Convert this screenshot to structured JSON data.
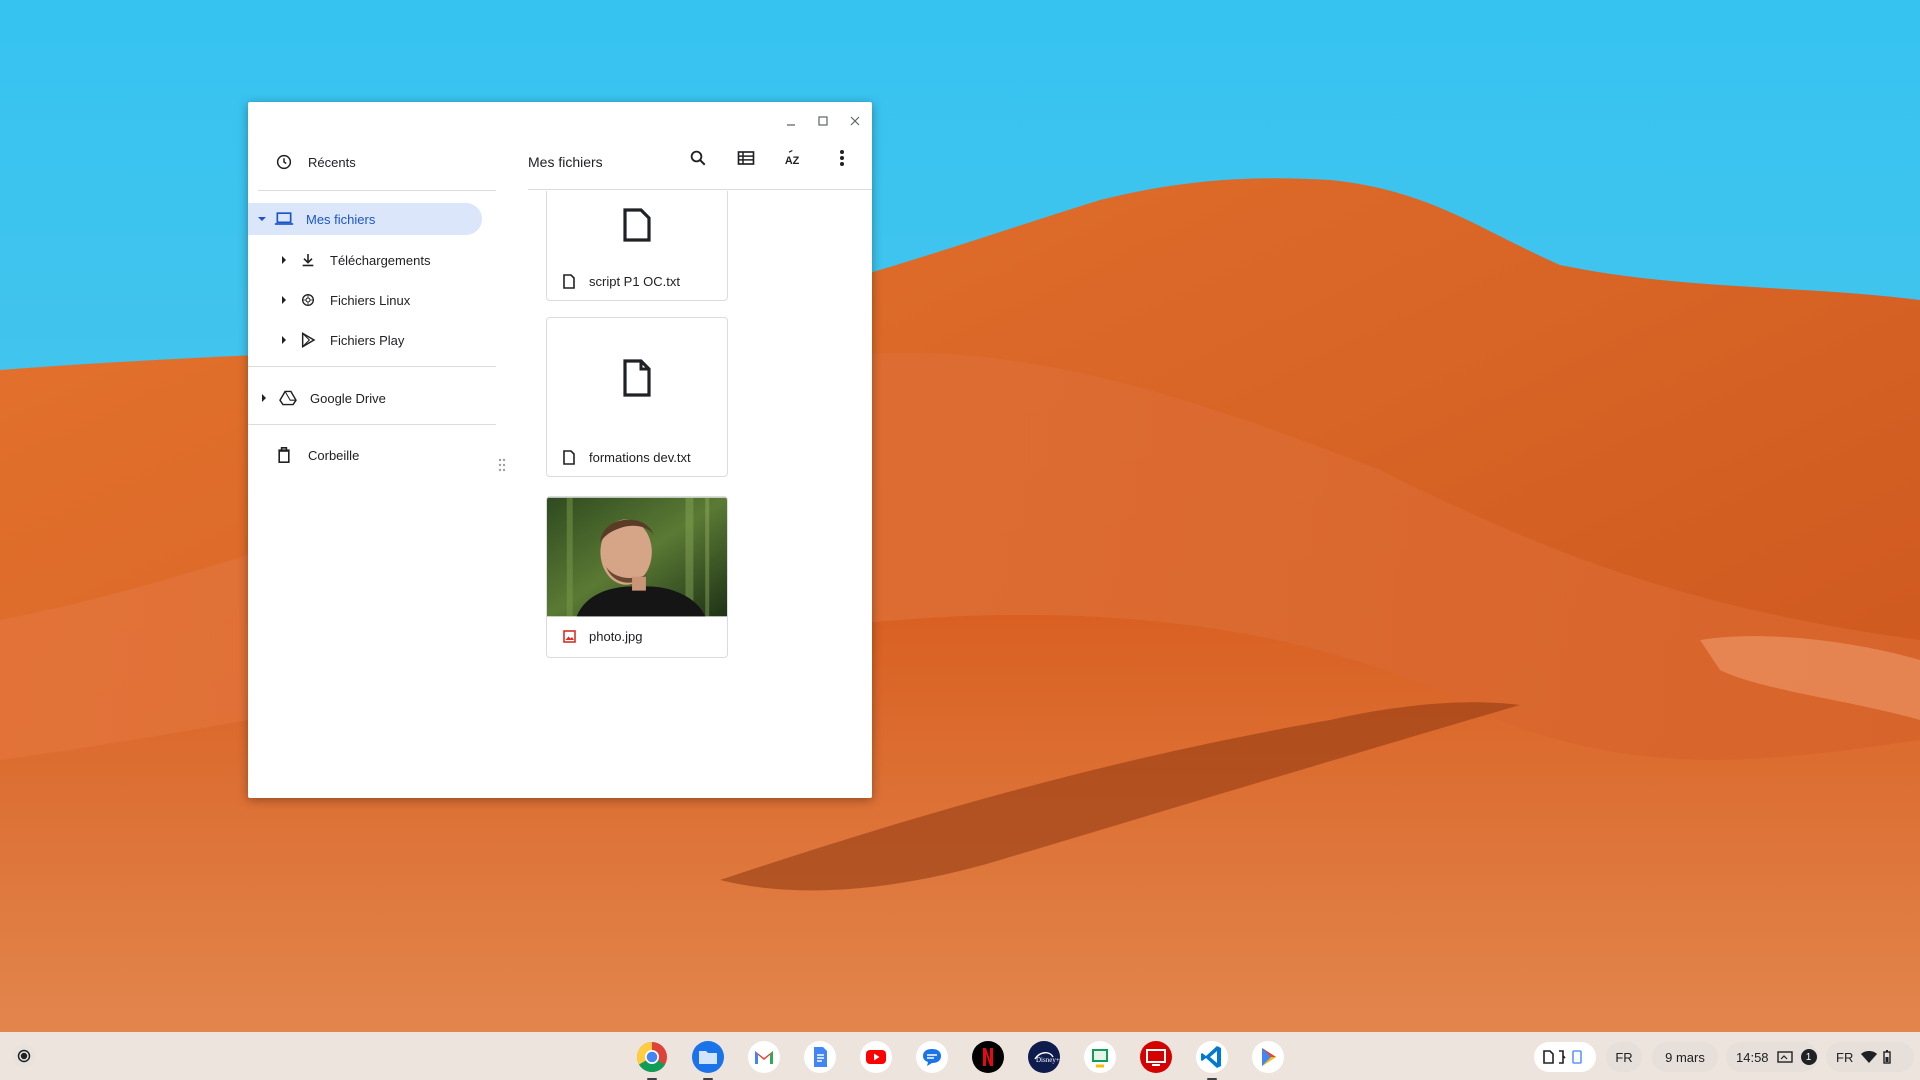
{
  "colors": {
    "sky": "#3cc3ee",
    "sand": "#e2692a",
    "active_nav_bg": "#dbe6fb",
    "active_nav_text": "#1a56c6",
    "shelf_bg": "#eee8e4"
  },
  "window": {
    "controls": [
      {
        "name": "minimize",
        "icon": "minimize-icon"
      },
      {
        "name": "maximize",
        "icon": "maximize-icon"
      },
      {
        "name": "close",
        "icon": "close-icon"
      }
    ]
  },
  "sidebar": {
    "recent": {
      "label": "Récents",
      "icon": "clock-icon"
    },
    "my_files": {
      "label": "Mes fichiers",
      "icon": "laptop-icon",
      "expanded": true
    },
    "children": [
      {
        "label": "Téléchargements",
        "icon": "download-icon"
      },
      {
        "label": "Fichiers Linux",
        "icon": "linux-icon"
      },
      {
        "label": "Fichiers Play",
        "icon": "play-icon"
      }
    ],
    "drive": {
      "label": "Google Drive",
      "icon": "drive-icon"
    },
    "trash": {
      "label": "Corbeille",
      "icon": "trash-icon"
    }
  },
  "toolbar": {
    "breadcrumb": "Mes fichiers",
    "buttons": [
      {
        "name": "search",
        "icon": "search-icon"
      },
      {
        "name": "list-view",
        "icon": "list-view-icon"
      },
      {
        "name": "sort",
        "icon": "sort-az-icon"
      },
      {
        "name": "more",
        "icon": "more-vert-icon"
      }
    ]
  },
  "files": [
    {
      "name": "script P1 OC.txt",
      "type": "text",
      "icon": "file-icon"
    },
    {
      "name": "formations dev.txt",
      "type": "text",
      "icon": "file-icon"
    },
    {
      "name": "photo.jpg",
      "type": "image",
      "icon": "image-file-icon"
    }
  ],
  "shelf": {
    "apps": [
      {
        "name": "Chrome",
        "icon": "chrome-icon",
        "open": true
      },
      {
        "name": "Fichiers",
        "icon": "files-icon",
        "open": true
      },
      {
        "name": "Gmail",
        "icon": "gmail-icon",
        "open": false
      },
      {
        "name": "Docs",
        "icon": "docs-icon",
        "open": false
      },
      {
        "name": "YouTube",
        "icon": "youtube-icon",
        "open": false
      },
      {
        "name": "Messages",
        "icon": "messages-icon",
        "open": false
      },
      {
        "name": "Netflix",
        "icon": "netflix-icon",
        "open": false
      },
      {
        "name": "Disney+",
        "icon": "disney-plus-icon",
        "open": false
      },
      {
        "name": "Classroom",
        "icon": "classroom-icon",
        "open": false
      },
      {
        "name": "Remote Desktop",
        "icon": "remote-desktop-icon",
        "open": false
      },
      {
        "name": "VS Code",
        "icon": "vscode-icon",
        "open": true
      },
      {
        "name": "Play Store",
        "icon": "play-store-icon",
        "open": false
      }
    ],
    "tray": {
      "input_lang": "FR",
      "date": "9 mars",
      "time": "14:58",
      "notification_count": "1",
      "lang_status": "FR"
    }
  }
}
